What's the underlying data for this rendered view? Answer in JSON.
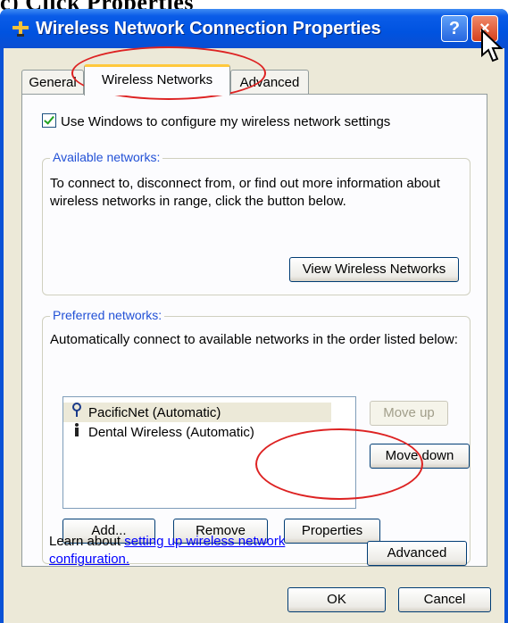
{
  "heading": "c) Click Properties",
  "window": {
    "title": "Wireless Network Connection Properties",
    "help_glyph": "?",
    "close_glyph": "×"
  },
  "tabs": [
    {
      "label": "General",
      "active": false
    },
    {
      "label": "Wireless Networks",
      "active": true
    },
    {
      "label": "Advanced",
      "active": false
    }
  ],
  "use_windows_checkbox": {
    "label": "Use Windows to configure my wireless network settings",
    "checked": true
  },
  "available": {
    "legend": "Available networks:",
    "text": "To connect to, disconnect from, or find out more information about wireless networks in range, click the button below.",
    "view_button": "View Wireless Networks"
  },
  "preferred": {
    "legend": "Preferred networks:",
    "text": "Automatically connect to available networks in the order listed below:",
    "networks": [
      {
        "name": "PacificNet (Automatic)",
        "icon": "wireless-antenna-icon",
        "selected": true
      },
      {
        "name": "Dental Wireless (Automatic)",
        "icon": "wireless-disconnected-icon",
        "selected": false
      }
    ],
    "move_up": "Move up",
    "move_down": "Move down",
    "add": "Add...",
    "remove": "Remove",
    "properties": "Properties",
    "learn_prefix": "Learn about ",
    "learn_link": "setting up wireless network configuration.",
    "advanced": "Advanced"
  },
  "footer": {
    "ok": "OK",
    "cancel": "Cancel"
  },
  "colors": {
    "titlebar": "#0053e0",
    "dialog_bg": "#ece9d8",
    "highlight_ellipse": "#d22222",
    "tab_accent": "#ffc83c"
  }
}
